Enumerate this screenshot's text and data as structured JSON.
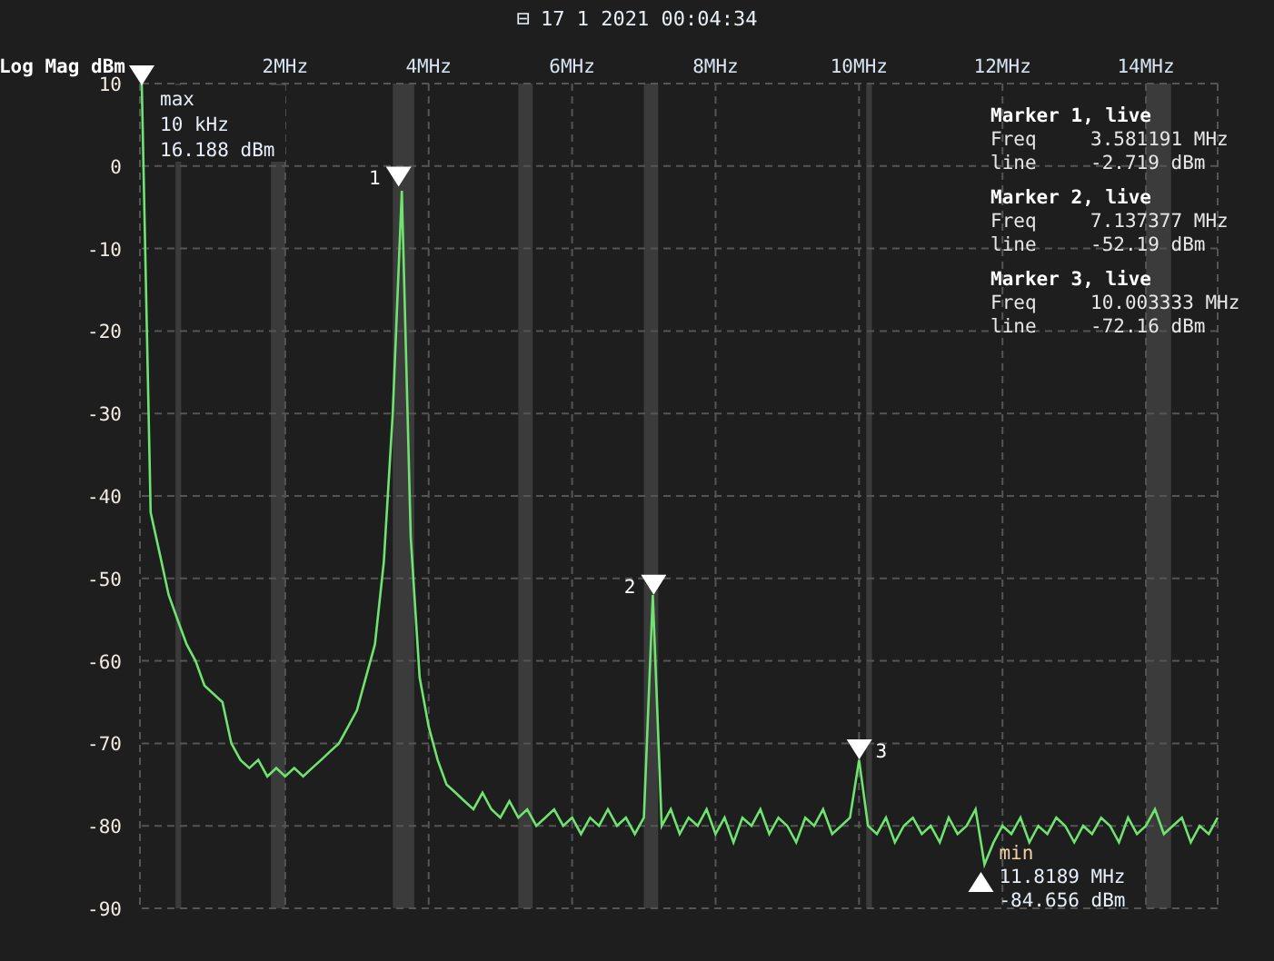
{
  "header": {
    "icon": "⊟",
    "timestamp": "17 1 2021 00:04:34"
  },
  "chart": {
    "chart_data": {
      "type": "line",
      "ylabel": "Log Mag dBm",
      "grid": true,
      "xlim": [
        0,
        15
      ],
      "ylim": [
        -90,
        10
      ],
      "xticks": [
        {
          "value": 2,
          "label": "2MHz"
        },
        {
          "value": 4,
          "label": "4MHz"
        },
        {
          "value": 6,
          "label": "6MHz"
        },
        {
          "value": 8,
          "label": "8MHz"
        },
        {
          "value": 10,
          "label": "10MHz"
        },
        {
          "value": 12,
          "label": "12MHz"
        },
        {
          "value": 14,
          "label": "14MHz"
        }
      ],
      "yticks": [
        10,
        0,
        -10,
        -20,
        -30,
        -40,
        -50,
        -60,
        -70,
        -80,
        -90
      ],
      "x": [
        0,
        0.125,
        0.25,
        0.375,
        0.5,
        0.625,
        0.75,
        0.875,
        1,
        1.125,
        1.25,
        1.375,
        1.5,
        1.625,
        1.75,
        1.875,
        2,
        2.125,
        2.25,
        2.375,
        2.5,
        2.625,
        2.75,
        2.875,
        3,
        3.125,
        3.25,
        3.375,
        3.5,
        3.625,
        3.75,
        3.875,
        4,
        4.125,
        4.25,
        4.375,
        4.5,
        4.625,
        4.75,
        4.875,
        5,
        5.125,
        5.25,
        5.375,
        5.5,
        5.625,
        5.75,
        5.875,
        6,
        6.125,
        6.25,
        6.375,
        6.5,
        6.625,
        6.75,
        6.875,
        7,
        7.125,
        7.25,
        7.375,
        7.5,
        7.625,
        7.75,
        7.875,
        8,
        8.125,
        8.25,
        8.375,
        8.5,
        8.625,
        8.75,
        8.875,
        9,
        9.125,
        9.25,
        9.375,
        9.5,
        9.625,
        9.75,
        9.875,
        10,
        10.125,
        10.25,
        10.375,
        10.5,
        10.625,
        10.75,
        10.875,
        11,
        11.125,
        11.25,
        11.375,
        11.5,
        11.625,
        11.75,
        11.875,
        12,
        12.125,
        12.25,
        12.375,
        12.5,
        12.625,
        12.75,
        12.875,
        13,
        13.125,
        13.25,
        13.375,
        13.5,
        13.625,
        13.75,
        13.875,
        14,
        14.125,
        14.25,
        14.375,
        14.5,
        14.625,
        14.75,
        14.875,
        15
      ],
      "series": [
        {
          "color": "#6fe36f",
          "values": [
            10,
            -42,
            -47,
            -52,
            -55,
            -58,
            -60,
            -63,
            -64,
            -65,
            -70,
            -72,
            -73,
            -72,
            -74,
            -73,
            -74,
            -73,
            -74,
            -73,
            -72,
            -71,
            -70,
            -68,
            -66,
            -62,
            -58,
            -48,
            -30,
            -3,
            -45,
            -62,
            -68,
            -72,
            -75,
            -76,
            -77,
            -78,
            -76,
            -78,
            -79,
            -77,
            -79,
            -78,
            -80,
            -79,
            -78,
            -80,
            -79,
            -81,
            -79,
            -80,
            -78,
            -80,
            -79,
            -81,
            -79,
            -52,
            -80,
            -78,
            -81,
            -79,
            -80,
            -78,
            -81,
            -79,
            -82,
            -79,
            -80,
            -78,
            -81,
            -79,
            -80,
            -82,
            -79,
            -80,
            -78,
            -81,
            -80,
            -79,
            -72,
            -80,
            -81,
            -79,
            -82,
            -80,
            -79,
            -81,
            -80,
            -82,
            -79,
            -81,
            -80,
            -78,
            -84.7,
            -82,
            -80,
            -81,
            -79,
            -82,
            -80,
            -81,
            -79,
            -80,
            -82,
            -80,
            -81,
            -79,
            -80,
            -82,
            -79,
            -81,
            -80,
            -78,
            -81,
            -80,
            -79,
            -82,
            -80,
            -81,
            -79
          ]
        }
      ],
      "annotations": [
        {
          "x": 3.581191,
          "y": -2.719,
          "text": "1"
        },
        {
          "x": 7.137377,
          "y": -52.19,
          "text": "2"
        },
        {
          "x": 10.003333,
          "y": -72.16,
          "text": "3"
        }
      ]
    },
    "max": {
      "lines": [
        "max",
        "10 kHz",
        "16.188 dBm"
      ]
    },
    "min": {
      "lines": [
        "min",
        "11.8189 MHz",
        "-84.656 dBm"
      ]
    },
    "marker_panel": [
      {
        "title": "Marker 1, live",
        "rows": [
          {
            "label": "Freq",
            "value": "3.581191 MHz"
          },
          {
            "label": "line",
            "value": "-2.719 dBm"
          }
        ]
      },
      {
        "title": "Marker 2, live",
        "rows": [
          {
            "label": "Freq",
            "value": "7.137377 MHz"
          },
          {
            "label": "line",
            "value": "-52.19 dBm"
          }
        ]
      },
      {
        "title": "Marker 3, live",
        "rows": [
          {
            "label": "Freq",
            "value": "10.003333 MHz"
          },
          {
            "label": "line",
            "value": "-72.16 dBm"
          }
        ]
      }
    ]
  }
}
